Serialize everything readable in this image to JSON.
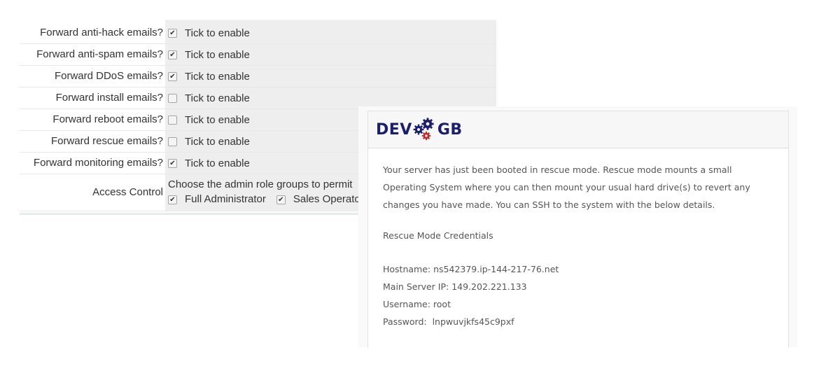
{
  "settings": {
    "rows": [
      {
        "label": "Forward anti-hack emails?",
        "checked": true,
        "option_label": "Tick to enable"
      },
      {
        "label": "Forward anti-spam emails?",
        "checked": true,
        "option_label": "Tick to enable"
      },
      {
        "label": "Forward DDoS emails?",
        "checked": true,
        "option_label": "Tick to enable"
      },
      {
        "label": "Forward install emails?",
        "checked": false,
        "option_label": "Tick to enable"
      },
      {
        "label": "Forward reboot emails?",
        "checked": false,
        "option_label": "Tick to enable"
      },
      {
        "label": "Forward rescue emails?",
        "checked": false,
        "option_label": "Tick to enable"
      },
      {
        "label": "Forward monitoring emails?",
        "checked": true,
        "option_label": "Tick to enable"
      }
    ],
    "access_control": {
      "label": "Access Control",
      "description": "Choose the admin role groups to permit",
      "options": [
        {
          "label": "Full Administrator",
          "checked": true
        },
        {
          "label": "Sales Operato",
          "checked": true
        }
      ]
    }
  },
  "email": {
    "logo": {
      "left": "DEV",
      "right": "GB",
      "colors": {
        "text": "#1b1f6b",
        "gear_primary": "#1b1f6b",
        "gear_accent": "#c0282d"
      }
    },
    "intro": "Your server has just been booted in rescue mode. Rescue mode mounts a small Operating System where you can then mount your usual hard drive(s) to revert any changes you have made. You can SSH to the system with the below details.",
    "heading": "Rescue Mode Credentials",
    "credentials": [
      {
        "label": "Hostname:",
        "value": "ns542379.ip-144-217-76.net"
      },
      {
        "label": "Main Server IP:",
        "value": "149.202.221.133"
      },
      {
        "label": "Username:",
        "value": "root"
      },
      {
        "label": "Password:",
        "value": " lnpwuvjkfs45c9pxf"
      }
    ]
  }
}
